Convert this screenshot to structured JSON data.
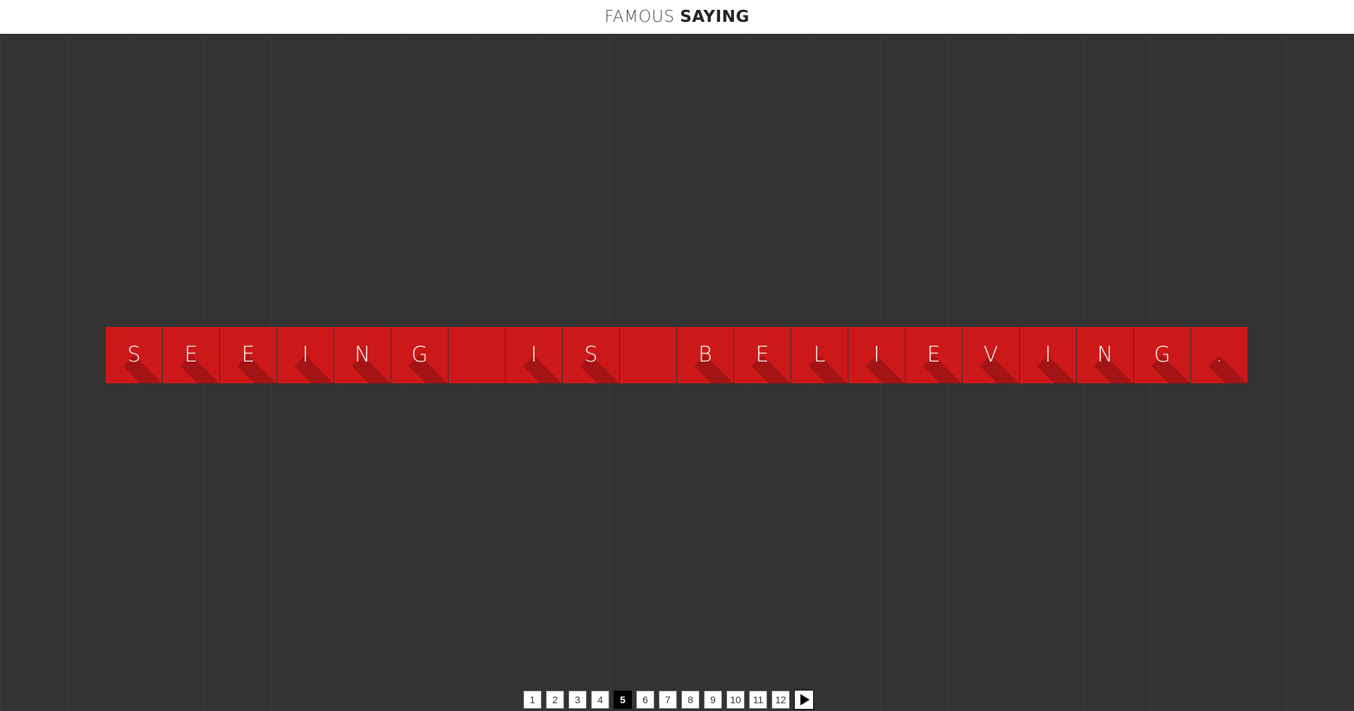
{
  "header": {
    "title_light": "FAMOUS",
    "title_bold": "SAYING"
  },
  "saying": {
    "letters": [
      "S",
      "E",
      "E",
      "I",
      "N",
      "G",
      " ",
      "I",
      "S",
      " ",
      "B",
      "E",
      "L",
      "I",
      "E",
      "V",
      "I",
      "N",
      "G",
      "."
    ]
  },
  "colors": {
    "tile": "#cc1818",
    "tile_shadow": "#9e1414",
    "background": "#333333"
  },
  "pagination": {
    "pages": [
      "1",
      "2",
      "3",
      "4",
      "5",
      "6",
      "7",
      "8",
      "9",
      "10",
      "11",
      "12"
    ],
    "current": "5",
    "next_icon": "play-icon"
  }
}
